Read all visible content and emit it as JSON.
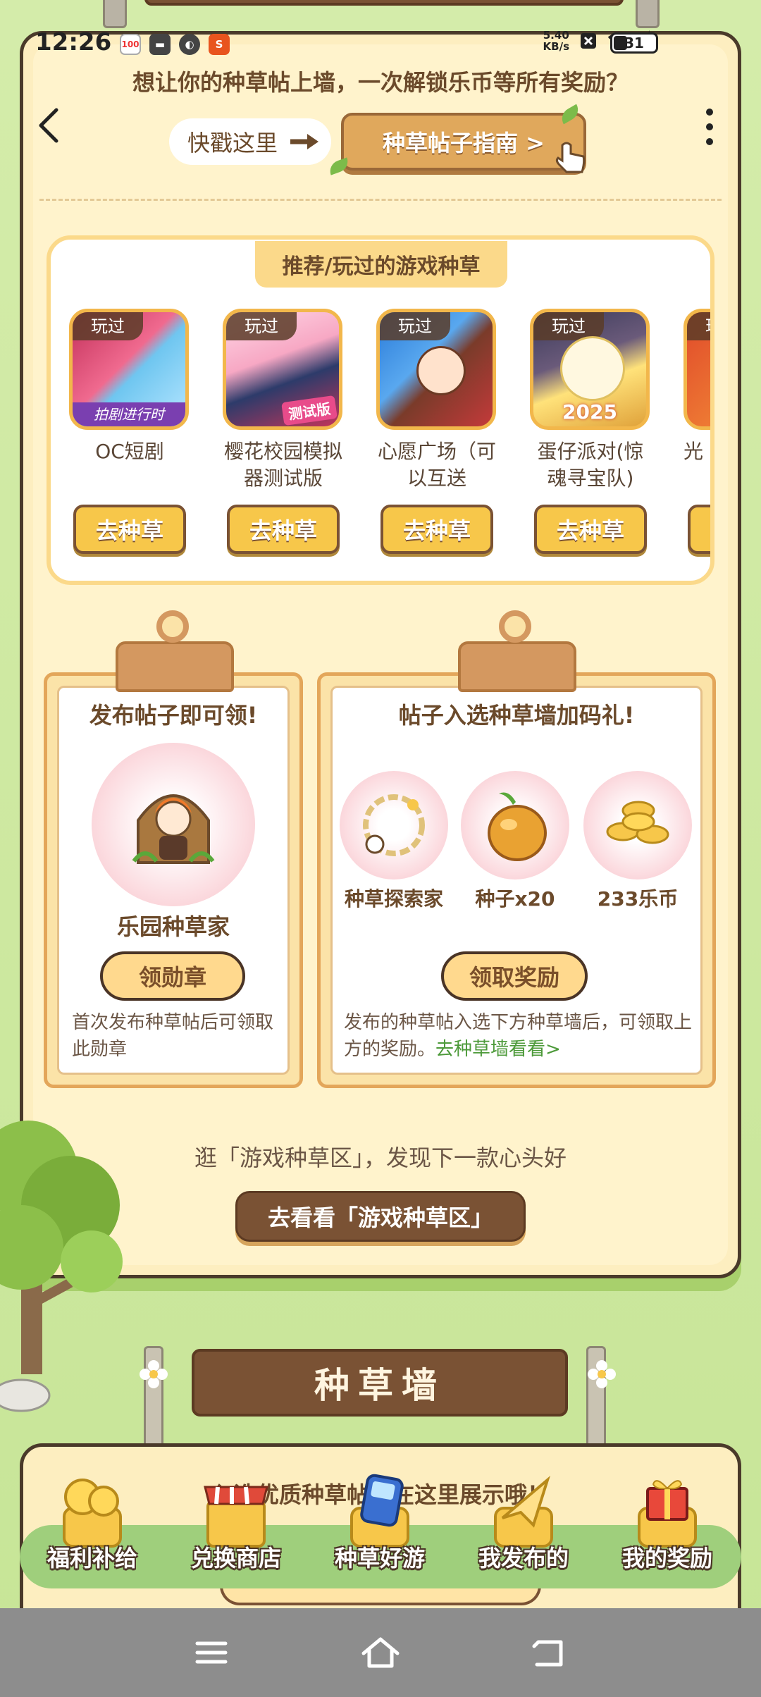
{
  "status_bar": {
    "time": "12:26",
    "net_speed_value": "5.40",
    "net_speed_unit": "KB/s",
    "battery": "31"
  },
  "header": {
    "headline": "想让你的种草帖上墙，一次解锁乐币等所有奖励？",
    "quick_label": "快戳这里",
    "guide_button": "种草帖子指南 >"
  },
  "recommended": {
    "title": "推荐/玩过的游戏种草",
    "played_tag": "玩过",
    "button_label": "去种草",
    "games": [
      {
        "name": "OC短剧",
        "thumb_text": "拍剧进行时"
      },
      {
        "name": "樱花校园模拟器测试版",
        "thumb_text": "测试版"
      },
      {
        "name": "心愿广场（可以互送",
        "thumb_text": ""
      },
      {
        "name": "蛋仔派对(惊魂寻宝队)",
        "thumb_text": "2025"
      },
      {
        "name": "光",
        "thumb_text": ""
      }
    ]
  },
  "post_reward": {
    "title": "发布帖子即可领!",
    "badge_name": "乐园种草家",
    "button": "领勋章",
    "note": "首次发布种草帖后可领取此勋章"
  },
  "wall_reward": {
    "title": "帖子入选种草墙加码礼!",
    "items": [
      {
        "label": "种草探索家"
      },
      {
        "label": "种子x20"
      },
      {
        "label": "233乐币"
      }
    ],
    "button": "领取奖励",
    "note": "发布的种草帖入选下方种草墙后，可领取上方的奖励。",
    "link": "去种草墙看看>"
  },
  "browse": {
    "text": "逛「游戏种草区」，发现下一款心头好",
    "button": "去看看「游戏种草区」"
  },
  "wall": {
    "sign": "种草墙",
    "subtitle": "入选优质种草帖会在这里展示哦！"
  },
  "bottom_nav": [
    {
      "label": "福利补给"
    },
    {
      "label": "兑换商店"
    },
    {
      "label": "种草好游"
    },
    {
      "label": "我发布的"
    },
    {
      "label": "我的奖励"
    }
  ],
  "colors": {
    "background": "#cfe8a2",
    "card": "#fff3cc",
    "brown": "#7a5234",
    "gold": "#f7c74a",
    "link_green": "#4d9a3a"
  }
}
